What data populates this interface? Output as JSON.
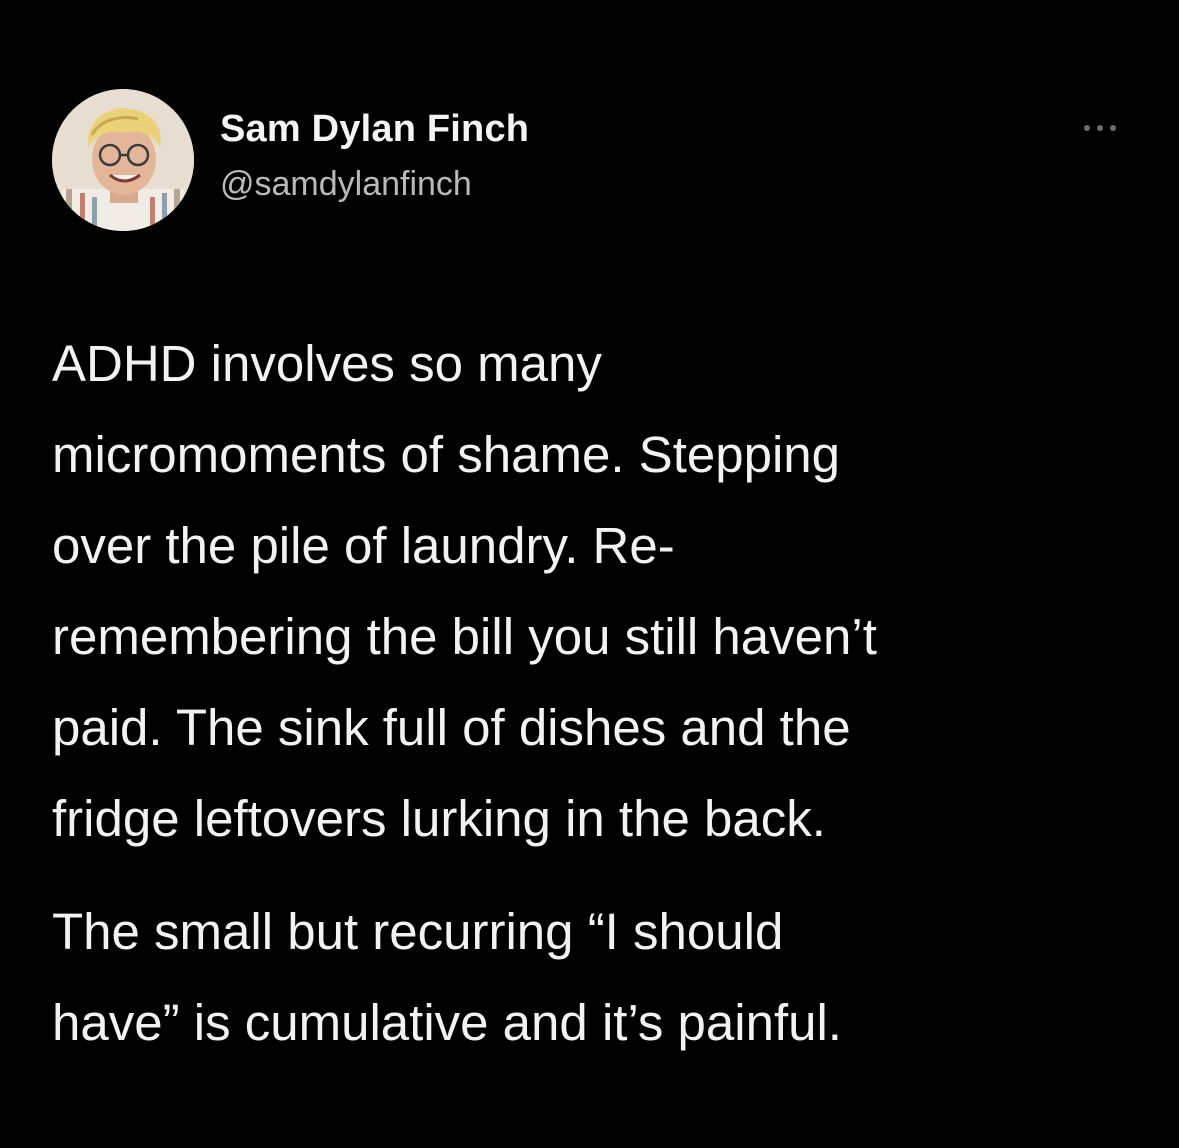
{
  "tweet": {
    "author": {
      "display_name": "Sam Dylan Finch",
      "handle": "@samdylanfinch",
      "avatar_icon": "profile-photo"
    },
    "more_icon": "more-options-icon",
    "paragraphs": [
      {
        "lines": [
          "ADHD involves so many",
          "micromoments of shame. Stepping",
          "over the pile of laundry. Re-",
          "remembering the bill you still haven’t",
          "paid. The sink full of dishes and the",
          "fridge leftovers lurking in the back."
        ]
      },
      {
        "lines": [
          "The small but recurring “I should",
          "have” is cumulative and it’s painful."
        ]
      }
    ]
  },
  "colors": {
    "background": "#000000",
    "text": "#f2f2f2",
    "handle": "#b9b9b9",
    "more_dots": "#6b6b6b"
  }
}
